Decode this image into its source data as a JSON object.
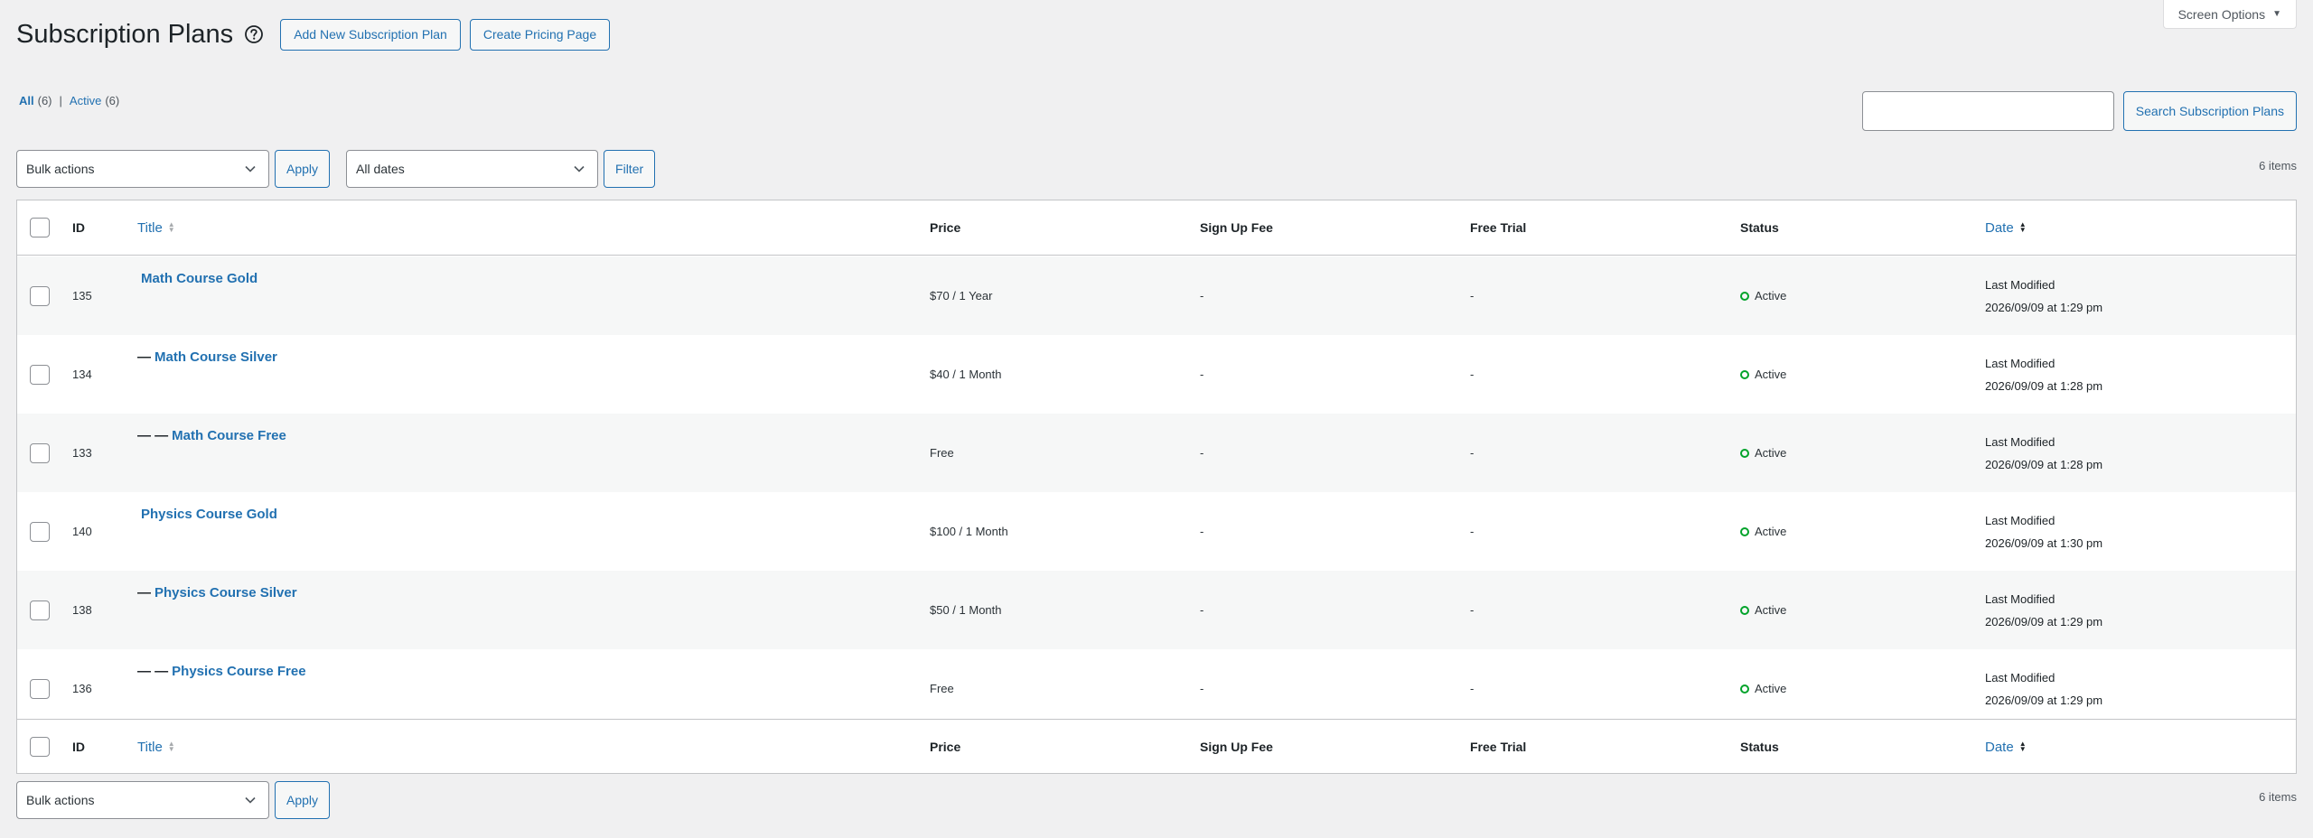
{
  "header": {
    "title": "Subscription Plans",
    "add_new_label": "Add New Subscription Plan",
    "create_pricing_label": "Create Pricing Page"
  },
  "screen_options": {
    "label": "Screen Options"
  },
  "views": {
    "all_label": "All",
    "all_count": "(6)",
    "separator": "|",
    "active_label": "Active",
    "active_count": "(6)"
  },
  "search": {
    "button_label": "Search Subscription Plans",
    "value": ""
  },
  "top_nav": {
    "bulk_actions": "Bulk actions",
    "apply_label": "Apply",
    "dates": "All dates",
    "filter_label": "Filter",
    "items_count": "6 items"
  },
  "columns": {
    "id": "ID",
    "title": "Title",
    "price": "Price",
    "sign_up_fee": "Sign Up Fee",
    "free_trial": "Free Trial",
    "status": "Status",
    "date": "Date"
  },
  "rows": [
    {
      "id": "135",
      "prefix": "",
      "title": "Math Course Gold",
      "price": "$70 / 1 Year",
      "fee": "-",
      "trial": "-",
      "status": "Active",
      "date_label": "Last Modified",
      "date": "2026/09/09 at 1:29 pm"
    },
    {
      "id": "134",
      "prefix": "—",
      "title": "Math Course Silver",
      "price": "$40 / 1 Month",
      "fee": "-",
      "trial": "-",
      "status": "Active",
      "date_label": "Last Modified",
      "date": "2026/09/09 at 1:28 pm"
    },
    {
      "id": "133",
      "prefix": "— —",
      "title": "Math Course Free",
      "price": "Free",
      "fee": "-",
      "trial": "-",
      "status": "Active",
      "date_label": "Last Modified",
      "date": "2026/09/09 at 1:28 pm"
    },
    {
      "id": "140",
      "prefix": "",
      "title": "Physics Course Gold",
      "price": "$100 / 1 Month",
      "fee": "-",
      "trial": "-",
      "status": "Active",
      "date_label": "Last Modified",
      "date": "2026/09/09 at 1:30 pm"
    },
    {
      "id": "138",
      "prefix": "—",
      "title": "Physics Course Silver",
      "price": "$50 / 1 Month",
      "fee": "-",
      "trial": "-",
      "status": "Active",
      "date_label": "Last Modified",
      "date": "2026/09/09 at 1:29 pm"
    },
    {
      "id": "136",
      "prefix": "— —",
      "title": "Physics Course Free",
      "price": "Free",
      "fee": "-",
      "trial": "-",
      "status": "Active",
      "date_label": "Last Modified",
      "date": "2026/09/09 at 1:29 pm"
    }
  ],
  "bottom_nav": {
    "bulk_actions": "Bulk actions",
    "apply_label": "Apply",
    "items_count": "6 items"
  },
  "colors": {
    "link": "#2271b1",
    "active_status": "#00a32a",
    "background": "#f0f0f1"
  }
}
